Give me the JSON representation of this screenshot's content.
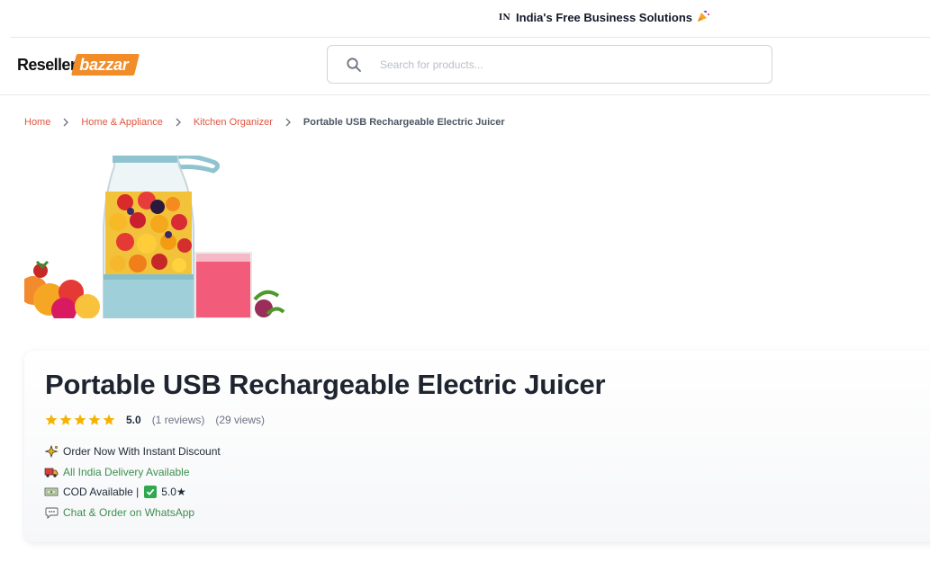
{
  "topbar": {
    "flag_code": "IN",
    "tagline": "India's Free Business Solutions",
    "emoji_icon": "party-popper-icon"
  },
  "header": {
    "logo": {
      "part1": "Reseller",
      "part2": "bazzar"
    },
    "search": {
      "placeholder": "Search for products...",
      "value": ""
    }
  },
  "breadcrumb": {
    "items": [
      "Home",
      "Home & Appliance",
      "Kitchen Organizer"
    ],
    "current": "Portable USB Rechargeable Electric Juicer"
  },
  "product": {
    "title": "Portable USB Rechargeable Electric Juicer",
    "rating_value": "5.0",
    "stars": 5,
    "reviews": "(1 reviews)",
    "views": "(29 views)",
    "features": {
      "discount": "Order Now With Instant Discount",
      "delivery": "All India Delivery Available",
      "cod_prefix": "COD Available |",
      "cod_rating": "5.0★",
      "whatsapp": "Chat & Order on WhatsApp"
    }
  },
  "colors": {
    "accent": "#f28c28",
    "link": "#e2553d",
    "green": "#3f8f4f",
    "star": "#f5b301"
  }
}
